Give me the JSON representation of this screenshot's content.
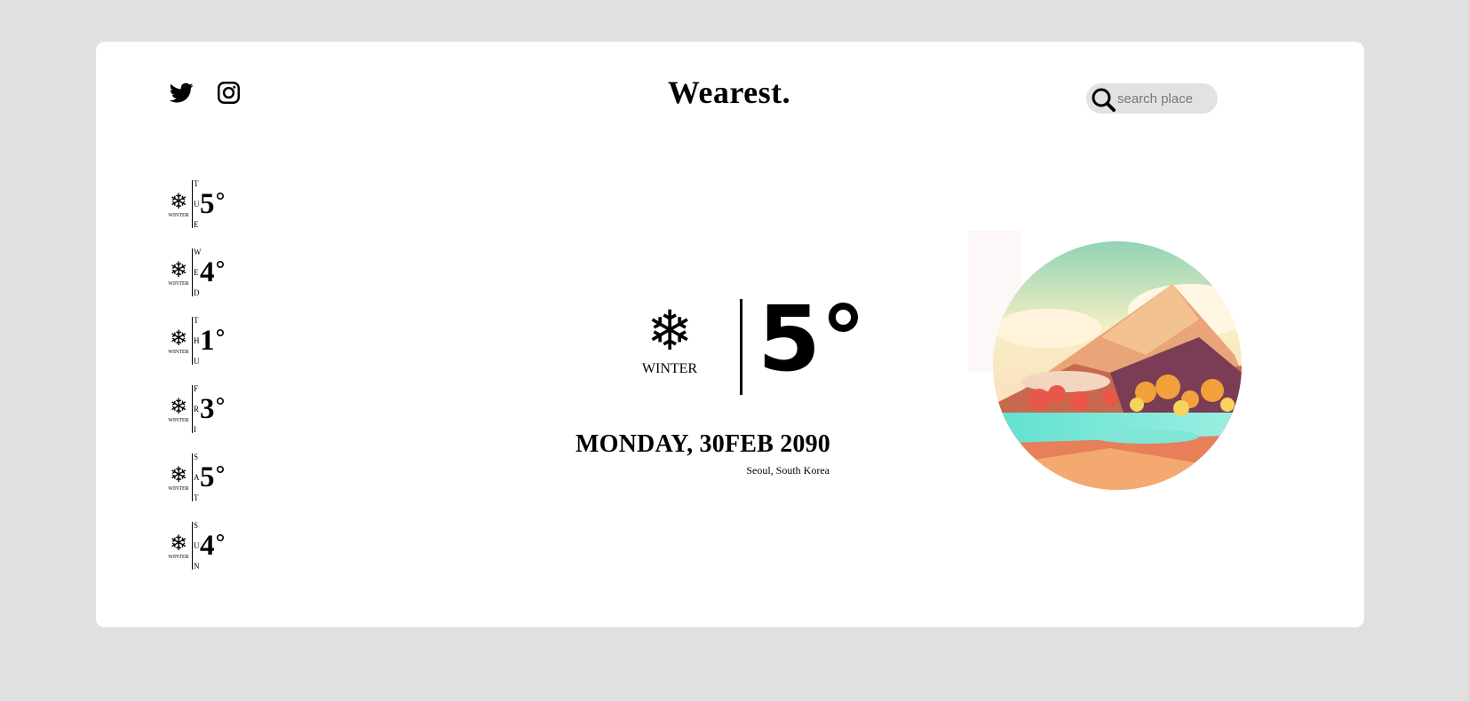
{
  "header": {
    "brand": "Wearest.",
    "social": [
      {
        "name": "twitter-icon"
      },
      {
        "name": "instagram-icon"
      }
    ],
    "search": {
      "placeholder": "search place",
      "value": ""
    }
  },
  "forecast": [
    {
      "letters": [
        "T",
        "U",
        "E"
      ],
      "temp": "5",
      "label": "WINTER",
      "icon": "snowflake-icon"
    },
    {
      "letters": [
        "W",
        "E",
        "D"
      ],
      "temp": "4",
      "label": "WINTER",
      "icon": "snowflake-icon"
    },
    {
      "letters": [
        "T",
        "H",
        "U"
      ],
      "temp": "1",
      "label": "WINTER",
      "icon": "snowflake-icon"
    },
    {
      "letters": [
        "F",
        "R",
        "I"
      ],
      "temp": "3",
      "label": "WINTER",
      "icon": "snowflake-icon"
    },
    {
      "letters": [
        "S",
        "A",
        "T"
      ],
      "temp": "5",
      "label": "WINTER",
      "icon": "snowflake-icon"
    },
    {
      "letters": [
        "S",
        "U",
        "N"
      ],
      "temp": "4",
      "label": "WINTER",
      "icon": "snowflake-icon"
    }
  ],
  "current": {
    "icon": "snowflake-icon",
    "season": "WINTER",
    "temp": "5°",
    "date": "MONDAY, 30FEB 2090",
    "location": "Seoul, South Korea"
  },
  "colors": {
    "background": "#e0e0e0",
    "card": "#ffffff",
    "search_bg": "#e2e2e2"
  }
}
